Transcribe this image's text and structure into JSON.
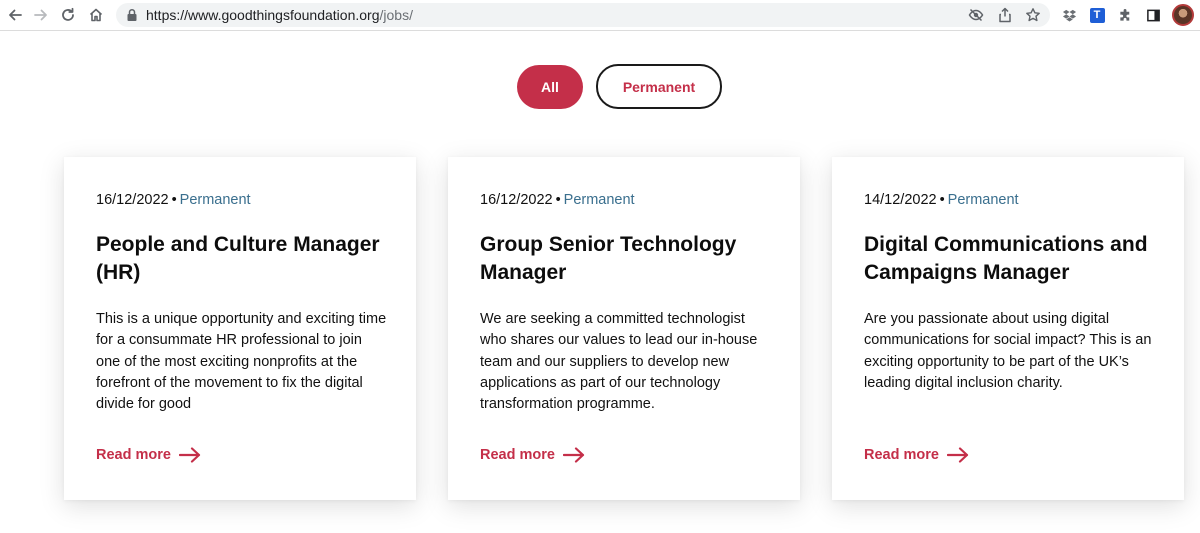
{
  "browser": {
    "url_host": "https://www.goodthingsfoundation.org",
    "url_path": "/jobs/",
    "icons": [
      "back-icon",
      "forward-icon",
      "reload-icon",
      "home-icon",
      "lock-icon",
      "eye-off-icon",
      "share-icon",
      "star-icon",
      "dropbox-icon",
      "extension-t-icon",
      "puzzle-icon",
      "sidebar-icon",
      "avatar"
    ],
    "extension_t_label": "T"
  },
  "filters": {
    "all_label": "All",
    "permanent_label": "Permanent",
    "active": "All"
  },
  "colors": {
    "accent": "#c42f49",
    "job_type": "#3a6f8e",
    "text": "#111111"
  },
  "jobs": [
    {
      "date": "16/12/2022",
      "separator": "•",
      "type": "Permanent",
      "title": "People and Culture Manager (HR)",
      "description": "This is a unique opportunity and exciting time for a consummate HR professional to join one of the most exciting nonprofits at the forefront of the movement to fix the digital divide for good",
      "link_label": "Read more"
    },
    {
      "date": "16/12/2022",
      "separator": "•",
      "type": "Permanent",
      "title": "Group Senior Technology Manager",
      "description": "We are seeking a committed technologist who shares our values to lead our in-house team and our suppliers to develop new applications as part of our technology transformation programme.",
      "link_label": "Read more"
    },
    {
      "date": "14/12/2022",
      "separator": "•",
      "type": "Permanent",
      "title": "Digital Communications and Campaigns Manager",
      "description": "Are you passionate about using digital communications for social impact? This is an exciting opportunity to be part of the UK’s leading digital inclusion charity.",
      "link_label": "Read more"
    }
  ]
}
